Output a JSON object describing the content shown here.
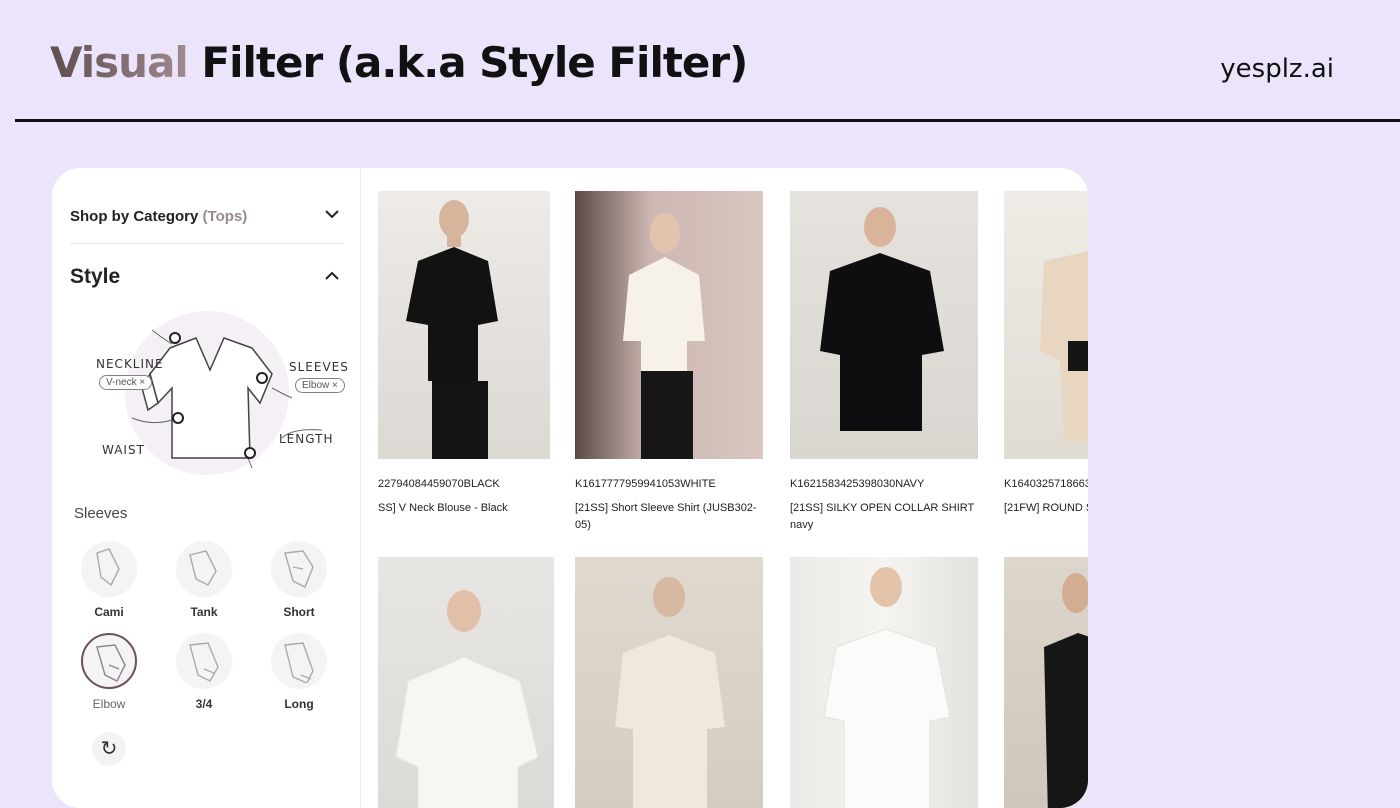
{
  "title": {
    "accent": "Visual",
    "rest": " Filter (a.k.a Style Filter)"
  },
  "brand": "yesplz.ai",
  "sidebar": {
    "category_label": "Shop by Category",
    "category_value": "(Tops)",
    "style_label": "Style",
    "diagram": {
      "neckline": "NECKLINE",
      "neckline_chip": "V-neck ×",
      "sleeves": "SLEEVES",
      "sleeves_chip": "Elbow ×",
      "waist": "WAIST",
      "length": "LENGTH"
    },
    "sleeves_title": "Sleeves",
    "options": [
      {
        "label": "Cami",
        "selected": false
      },
      {
        "label": "Tank",
        "selected": false
      },
      {
        "label": "Short",
        "selected": false
      },
      {
        "label": "Elbow",
        "selected": true
      },
      {
        "label": "3/4",
        "selected": false
      },
      {
        "label": "Long",
        "selected": false
      }
    ]
  },
  "products": [
    {
      "code": "22794084459070BLACK",
      "name": "SS] V Neck Blouse - Black"
    },
    {
      "code": "K1617777959941053WHITE",
      "name": "[21SS] Short Sleeve Shirt (JUSB302-05)"
    },
    {
      "code": "K1621583425398030NAVY",
      "name": "[21SS] SILKY OPEN COLLAR SHIRT navy"
    },
    {
      "code": "K1640325718663",
      "name": "[21FW] ROUND S"
    }
  ],
  "colors": {
    "background": "#ebe4fb",
    "accent": "#6a5257"
  }
}
